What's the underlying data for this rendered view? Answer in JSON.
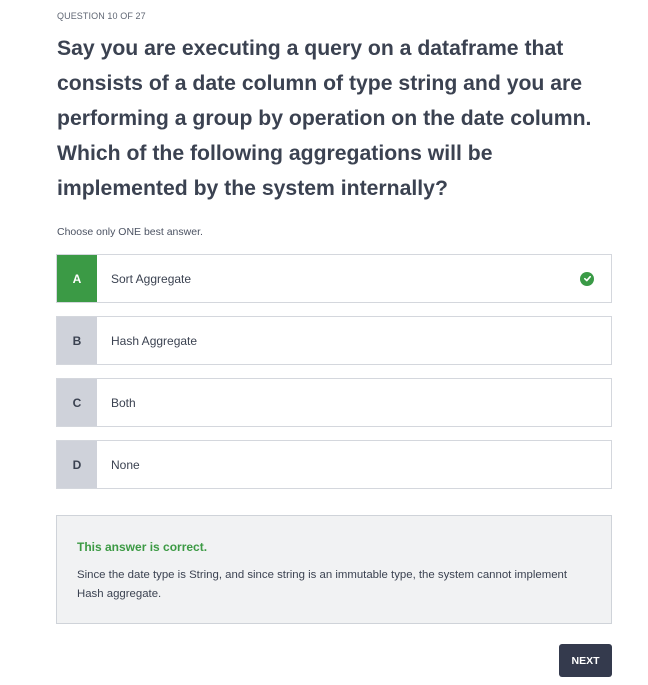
{
  "header": {
    "counter": "QUESTION 10 OF 27"
  },
  "question": {
    "text": "Say you are executing a query on a dataframe that consists of a date column of type string and you are performing a group by operation on the date column. Which of the following aggregations will be implemented by the system internally?"
  },
  "instruction": "Choose only ONE best answer.",
  "options": [
    {
      "letter": "A",
      "text": "Sort Aggregate",
      "selected": true,
      "icon": "check-circle-icon"
    },
    {
      "letter": "B",
      "text": "Hash Aggregate",
      "selected": false
    },
    {
      "letter": "C",
      "text": "Both",
      "selected": false
    },
    {
      "letter": "D",
      "text": "None",
      "selected": false
    }
  ],
  "feedback": {
    "verdict": "This answer is correct.",
    "explanation": "Since the date type is String, and since string is an immutable type, the system cannot implement Hash aggregate."
  },
  "footer": {
    "next_label": "NEXT"
  },
  "colors": {
    "correct_green": "#3b9a45",
    "letter_bg": "#cfd2da",
    "text_dark": "#3b4251",
    "button_dark": "#343a4d",
    "feedback_bg": "#f1f2f3"
  }
}
